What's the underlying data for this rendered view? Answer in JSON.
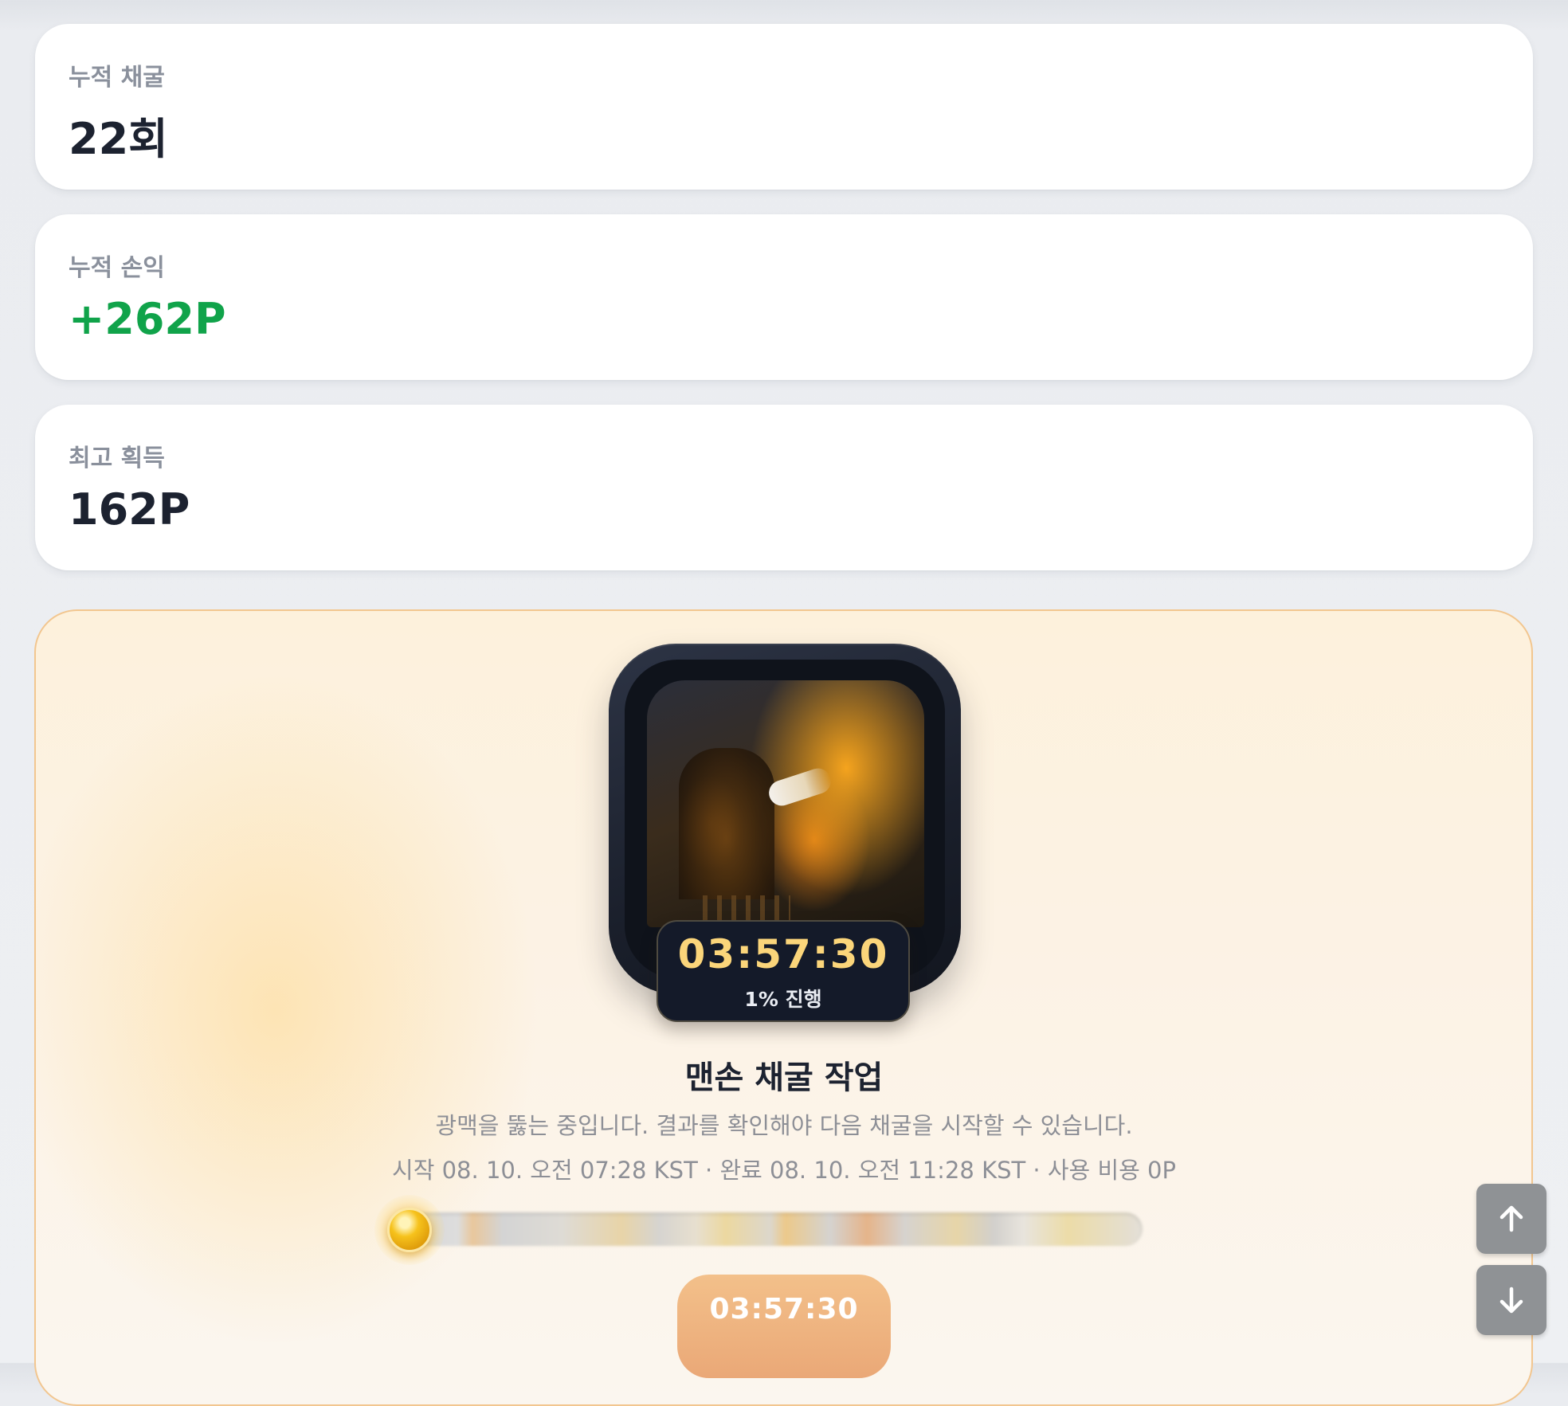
{
  "stats": [
    {
      "label": "누적 채굴",
      "value": "22회",
      "value_color": "#1c2230"
    },
    {
      "label": "누적 손익",
      "value": "+262P",
      "value_color": "#10a34a"
    },
    {
      "label": "최고 획득",
      "value": "162P",
      "value_color": "#1c2230"
    }
  ],
  "mining": {
    "timer": "03:57:30",
    "progress_text": "1% 진행",
    "progress_value": 0.01,
    "title": "맨손 채굴 작업",
    "description": "광맥을 뚫는 중입니다. 결과를 확인해야 다음 채굴을 시작할 수 있습니다.",
    "meta": "시작 08. 10. 오전 07:28 KST · 완료 08. 10. 오전 11:28 KST · 사용 비용 0P",
    "button_label": "03:57:30"
  },
  "scroll_controls": {
    "up_icon": "arrow-up-icon",
    "down_icon": "arrow-down-icon"
  },
  "colors": {
    "accent_gold": "#fbd57a",
    "profit_green": "#10a34a",
    "button_orange": "#eaa877"
  }
}
